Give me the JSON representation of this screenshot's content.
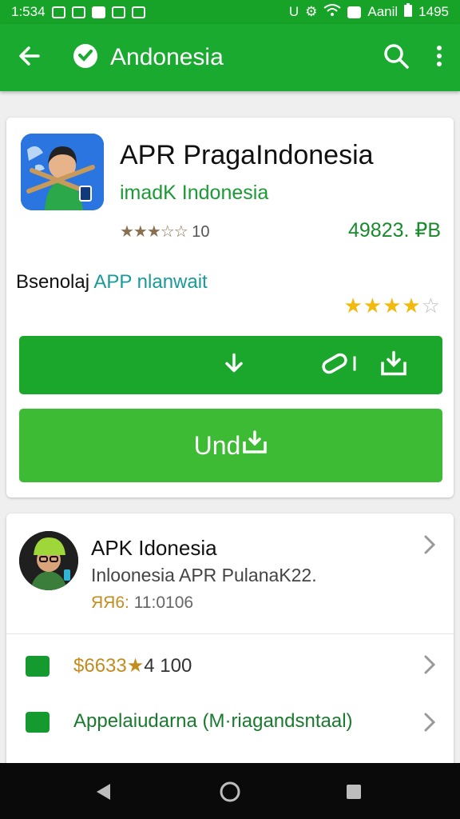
{
  "status_bar": {
    "time": "1:534",
    "carrier": "Aanil",
    "battery": "1495"
  },
  "app_bar": {
    "title": "Andonesia"
  },
  "app": {
    "title": "APR PragaIndonesia",
    "developer": "imadK Indonesia",
    "rating_stars": "★★★☆☆",
    "rating_count": "10",
    "price": "49823. ₽B",
    "desc_prefix": "Bsenolaj",
    "desc_accent": "APP nlanwait",
    "stars_filled": "★★★★",
    "stars_empty": "☆",
    "button2_label": "Und"
  },
  "developer": {
    "name": "APK Idonesia",
    "subtitle": "Inloonesia APR PulanaK22.",
    "meta_prefix": "ЯЯ6:",
    "meta_value": "11:0106"
  },
  "rows": [
    {
      "gold": "$6633★",
      "text": "4 100",
      "icon": "briefcase-icon"
    },
    {
      "gold": "",
      "text": "Appelaiudarna (M·riagandsntaal)",
      "icon": "chat-icon"
    }
  ],
  "colors": {
    "primary": "#1aaa30",
    "status": "#16a327",
    "button_dark": "#1aa72c",
    "button_light": "#3dbb35",
    "star": "#f2b90e"
  }
}
